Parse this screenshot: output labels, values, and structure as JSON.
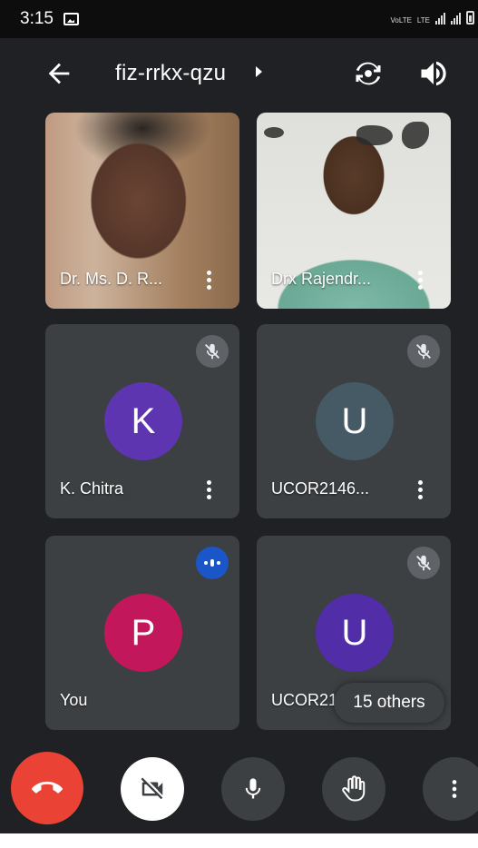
{
  "status_bar": {
    "time": "3:15",
    "network_1": "VoLTE",
    "network_2": "LTE"
  },
  "header": {
    "meeting_code": "fiz-rrkx-qzu"
  },
  "participants": [
    {
      "name": "Dr. Ms. D. R...",
      "type": "video"
    },
    {
      "name": "Drx Rajendr...",
      "type": "video"
    },
    {
      "name": "K. Chitra",
      "initial": "K",
      "avatar_color": "#5e35b1",
      "muted": true
    },
    {
      "name": "UCOR2146...",
      "initial": "U",
      "avatar_color": "#455a64",
      "muted": true
    },
    {
      "name": "You",
      "initial": "P",
      "avatar_color": "#c2185b",
      "speaking": true
    },
    {
      "name": "UCOR2146...",
      "initial": "U",
      "avatar_color": "#512da8",
      "muted": true
    }
  ],
  "overflow": {
    "label": "15 others"
  },
  "controls": {
    "end_call_color": "#ea4335",
    "camera": "camera-off",
    "mic": "mic-on",
    "hand": "raise-hand",
    "more": "more-options"
  }
}
